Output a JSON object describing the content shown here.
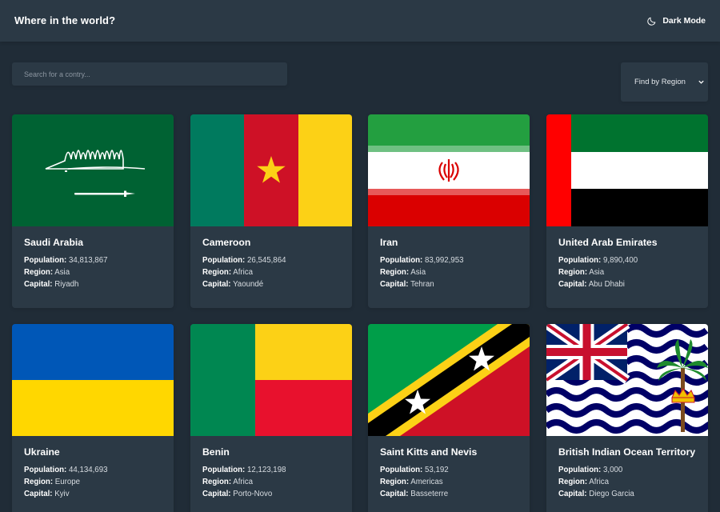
{
  "header": {
    "title": "Where in the world?",
    "mode_label": "Dark Mode"
  },
  "search": {
    "placeholder": "Search for a contry..."
  },
  "filter": {
    "label": "Find by Region"
  },
  "labels": {
    "population": "Population:",
    "region": "Region:",
    "capital": "Capital:"
  },
  "countries": [
    {
      "name": "Saudi Arabia",
      "population": "34,813,867",
      "region": "Asia",
      "capital": "Riyadh"
    },
    {
      "name": "Cameroon",
      "population": "26,545,864",
      "region": "Africa",
      "capital": "Yaoundé"
    },
    {
      "name": "Iran",
      "population": "83,992,953",
      "region": "Asia",
      "capital": "Tehran"
    },
    {
      "name": "United Arab Emirates",
      "population": "9,890,400",
      "region": "Asia",
      "capital": "Abu Dhabi"
    },
    {
      "name": "Ukraine",
      "population": "44,134,693",
      "region": "Europe",
      "capital": "Kyiv"
    },
    {
      "name": "Benin",
      "population": "12,123,198",
      "region": "Africa",
      "capital": "Porto-Novo"
    },
    {
      "name": "Saint Kitts and Nevis",
      "population": "53,192",
      "region": "Americas",
      "capital": "Basseterre"
    },
    {
      "name": "British Indian Ocean Territory",
      "population": "3,000",
      "region": "Africa",
      "capital": "Diego Garcia"
    }
  ],
  "colors": {
    "background": "#202c37",
    "element": "#2b3945",
    "text": "#ffffff"
  },
  "icons": {
    "mode": "moon-icon",
    "filter": "chevron-down-icon"
  }
}
